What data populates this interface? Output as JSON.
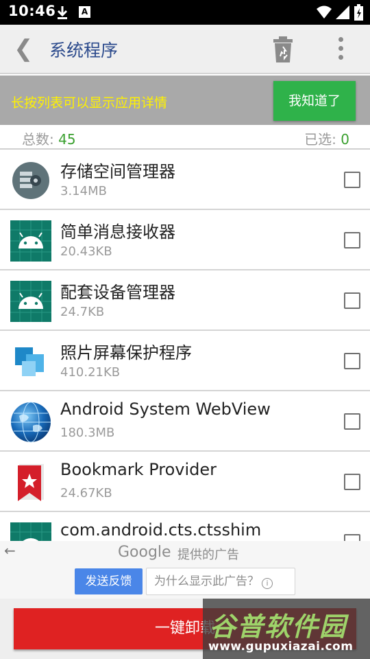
{
  "status_bar": {
    "time": "10:46",
    "notif_letter": "A"
  },
  "toolbar": {
    "title": "系统程序",
    "back_icon": "chevron-left-icon",
    "delete_icon": "trash-icon",
    "menu_icon": "more-vert-icon"
  },
  "hint": {
    "text": "长按列表可以显示应用详情",
    "button_label": "我知道了"
  },
  "counts": {
    "total_label": "总数: ",
    "total_value": "45",
    "selected_label": "已选: ",
    "selected_value": "0"
  },
  "apps": [
    {
      "name": "存储空间管理器",
      "size": "3.14MB",
      "icon": "storage-manager-icon"
    },
    {
      "name": "简单消息接收器",
      "size": "20.43KB",
      "icon": "android-icon"
    },
    {
      "name": "配套设备管理器",
      "size": "24.7KB",
      "icon": "android-icon"
    },
    {
      "name": "照片屏幕保护程序",
      "size": "410.21KB",
      "icon": "photo-screensaver-icon"
    },
    {
      "name": "Android System WebView",
      "size": "180.3MB",
      "icon": "globe-icon"
    },
    {
      "name": "Bookmark Provider",
      "size": "24.67KB",
      "icon": "bookmark-icon"
    },
    {
      "name": "com.android.cts.ctsshim",
      "size": "",
      "icon": "android-icon"
    }
  ],
  "ad": {
    "brand": "Google",
    "label": "提供的广告",
    "feedback_button": "发送反馈",
    "why_text": "为什么显示此广告？"
  },
  "bottom": {
    "uninstall_label": "一键卸载"
  },
  "watermark": {
    "title": "谷普软件园",
    "url": "www.gupuxiazai.com"
  },
  "colors": {
    "toolbar_title": "#2b4a8c",
    "hint_text": "#fff200",
    "hint_button": "#2fb24a",
    "count_value": "#3aa02f",
    "uninstall": "#df2222"
  }
}
